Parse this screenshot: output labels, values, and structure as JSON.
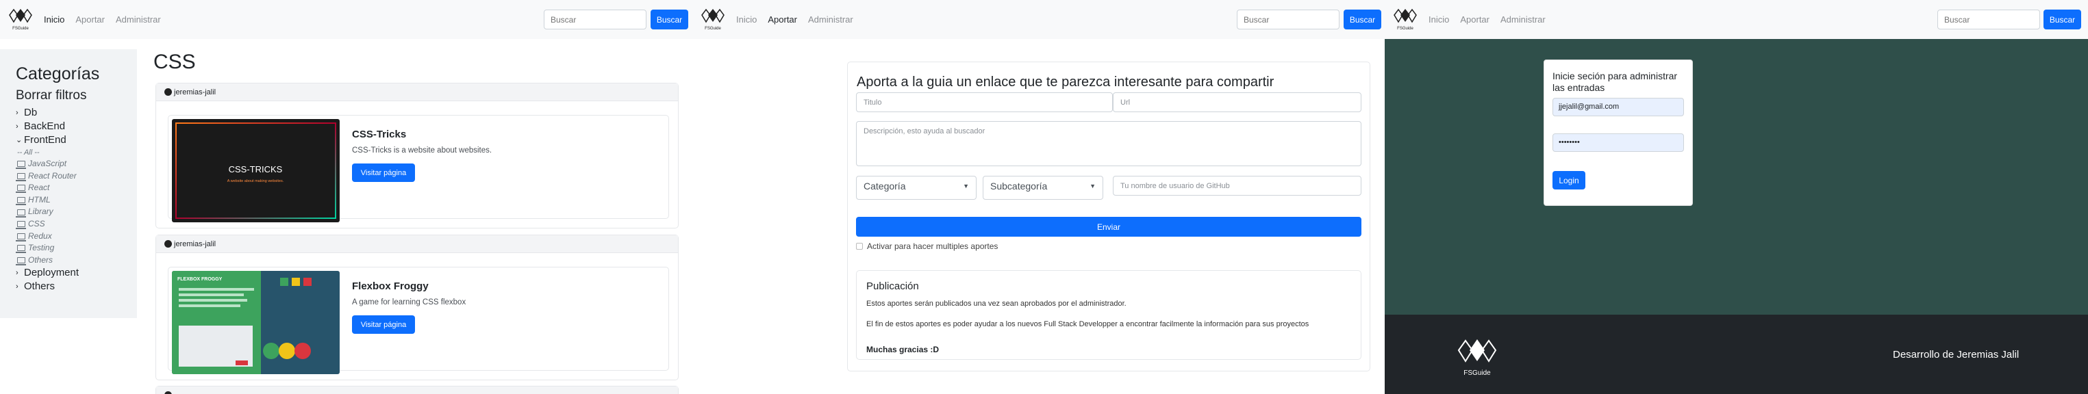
{
  "nav": {
    "logo_text": "FSGuide",
    "links": [
      "Inicio",
      "Aportar",
      "Administrar"
    ],
    "search_placeholder": "Buscar",
    "search_button": "Buscar"
  },
  "sidebar": {
    "title": "Categorías",
    "clear": "Borrar filtros",
    "categories_top": [
      "Db",
      "BackEnd",
      "FrontEnd"
    ],
    "all_label": "-- All --",
    "subcategories": [
      "JavaScript",
      "React Router",
      "React",
      "HTML",
      "Library",
      "CSS",
      "Redux",
      "Testing",
      "Others"
    ],
    "categories_bottom": [
      "Deployment",
      "Others"
    ]
  },
  "main": {
    "title": "CSS",
    "cards": [
      {
        "author": "jeremias-jalil",
        "title": "CSS-Tricks",
        "description": "CSS-Tricks is a website about websites.",
        "button": "Visitar página",
        "thumb_title": "CSS-TRICKS",
        "thumb_subtitle": "A website about making websites."
      },
      {
        "author": "jeremias-jalil",
        "title": "Flexbox Froggy",
        "description": "A game for learning CSS flexbox",
        "button": "Visitar página",
        "thumb_title": "FLEXBOX FROGGY"
      }
    ]
  },
  "contribute": {
    "title": "Aporta a la guia un enlace que te parezca interesante para compartir",
    "title_placeholder": "Titulo",
    "url_placeholder": "Url",
    "description_placeholder": "Descripción, esto ayuda al buscador",
    "category": "Categoría",
    "subcategory": "Subcategoría",
    "github_placeholder": "Tu nombre de usuario de GitHub",
    "submit": "Enviar",
    "multiple_label": "Activar para hacer multiples aportes",
    "publication": {
      "title": "Publicación",
      "line1": "Estos aportes serán publicados una vez sean aprobados por el administrador.",
      "line2": "El fin de estos aportes es poder ayudar a los nuevos Full Stack Developper a encontrar facilmente la información para sus proyectos",
      "thanks": "Muchas gracias :D"
    }
  },
  "login": {
    "title": "Inicie seción para administrar las entradas",
    "email": "jjejalil@gmail.com",
    "password": "••••••••",
    "button": "Login"
  },
  "footer": {
    "logo_text": "FSGuide",
    "credit": "Desarrollo de Jeremias Jalil"
  },
  "colors": {
    "primary": "#0d6efd",
    "login_bg": "#2f4f4a",
    "footer_bg": "#212529"
  }
}
